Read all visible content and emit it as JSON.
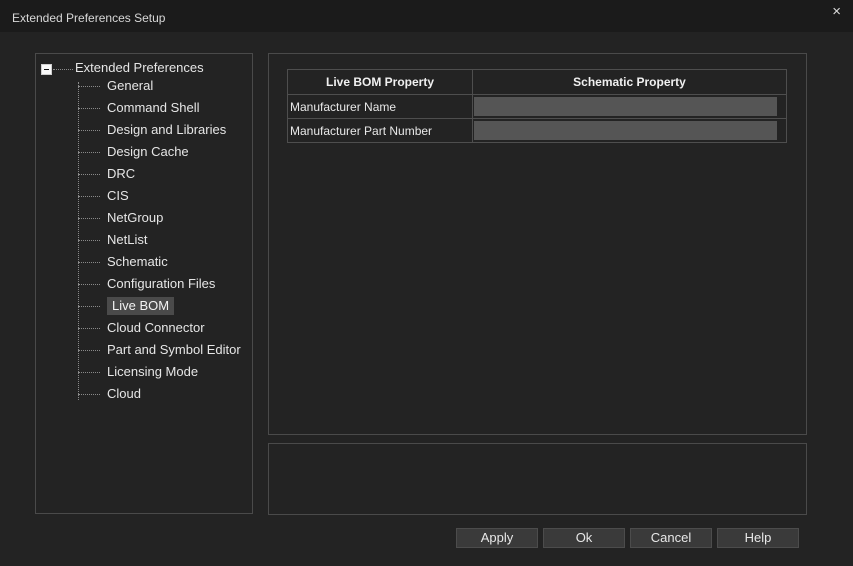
{
  "window": {
    "title": "Extended Preferences Setup",
    "close_glyph": "×"
  },
  "tree": {
    "root_label": "Extended Preferences",
    "items": [
      {
        "label": "General"
      },
      {
        "label": "Command Shell"
      },
      {
        "label": "Design and Libraries"
      },
      {
        "label": "Design Cache"
      },
      {
        "label": "DRC"
      },
      {
        "label": "CIS"
      },
      {
        "label": "NetGroup"
      },
      {
        "label": "NetList"
      },
      {
        "label": "Schematic"
      },
      {
        "label": "Configuration Files"
      },
      {
        "label": "Live BOM",
        "selected": true
      },
      {
        "label": "Cloud Connector"
      },
      {
        "label": "Part and Symbol Editor"
      },
      {
        "label": "Licensing Mode"
      },
      {
        "label": "Cloud"
      }
    ]
  },
  "mapping_table": {
    "headers": [
      "Live BOM Property",
      "Schematic Property"
    ],
    "rows": [
      {
        "live_bom": "Manufacturer Name",
        "schematic": ""
      },
      {
        "live_bom": "Manufacturer Part Number",
        "schematic": ""
      }
    ]
  },
  "buttons": {
    "apply": "Apply",
    "ok": "Ok",
    "cancel": "Cancel",
    "help": "Help"
  },
  "colors": {
    "background": "#232323",
    "titlebar": "#1b1b1b",
    "selection": "#4a4a4a",
    "input_fill": "#555555"
  }
}
